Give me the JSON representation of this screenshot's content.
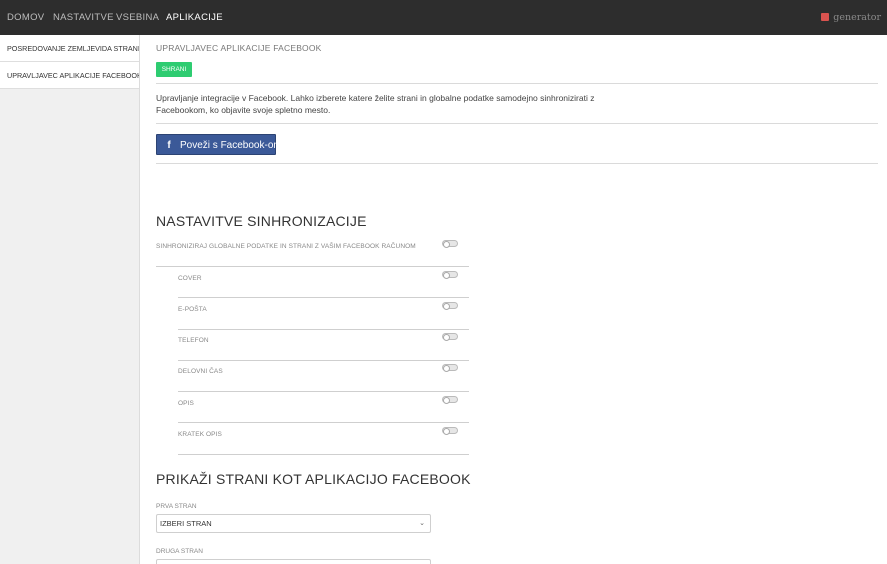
{
  "nav": {
    "items": [
      "DOMOV",
      "NASTAVITVE",
      "VSEBINA",
      "APLIKACIJE"
    ],
    "active_index": 3,
    "brand": "generator"
  },
  "sidebar": {
    "items": [
      {
        "label": "POSREDOVANJE ZEMLJEVIDA STRANI"
      },
      {
        "label": "UPRAVLJAVEC APLIKACIJE FACEBOOK"
      }
    ]
  },
  "main": {
    "title": "UPRAVLJAVEC APLIKACIJE FACEBOOK",
    "save_label": "SHRANI",
    "description": "Upravljanje integracije v Facebook. Lahko izberete katere želite strani in globalne podatke samodejno sinhronizirati z Facebookom, ko objavite svoje spletno mesto.",
    "fb_button_label": "Poveži s Facebook-om",
    "fb_icon": "f"
  },
  "sync": {
    "heading": "NASTAVITVE SINHRONIZACIJE",
    "global_label": "SINHRONIZIRAJ GLOBALNE PODATKE IN STRANI Z VAŠIM FACEBOOK RAČUNOM",
    "global_on": false,
    "items": [
      {
        "label": "COVER",
        "on": false
      },
      {
        "label": "E-POŠTA",
        "on": false
      },
      {
        "label": "TELEFON",
        "on": false
      },
      {
        "label": "DELOVNI ČAS",
        "on": false
      },
      {
        "label": "OPIS",
        "on": false
      },
      {
        "label": "KRATEK OPIS",
        "on": false
      }
    ]
  },
  "show_pages": {
    "heading": "PRIKAŽI STRANI KOT APLIKACIJO FACEBOOK",
    "first_label": "PRVA STRAN",
    "first_value": "IZBERI STRAN",
    "second_label": "DRUGA STRAN"
  },
  "colors": {
    "topbar": "#2d2d2d",
    "save": "#2ecc71",
    "facebook": "#3b5998"
  }
}
